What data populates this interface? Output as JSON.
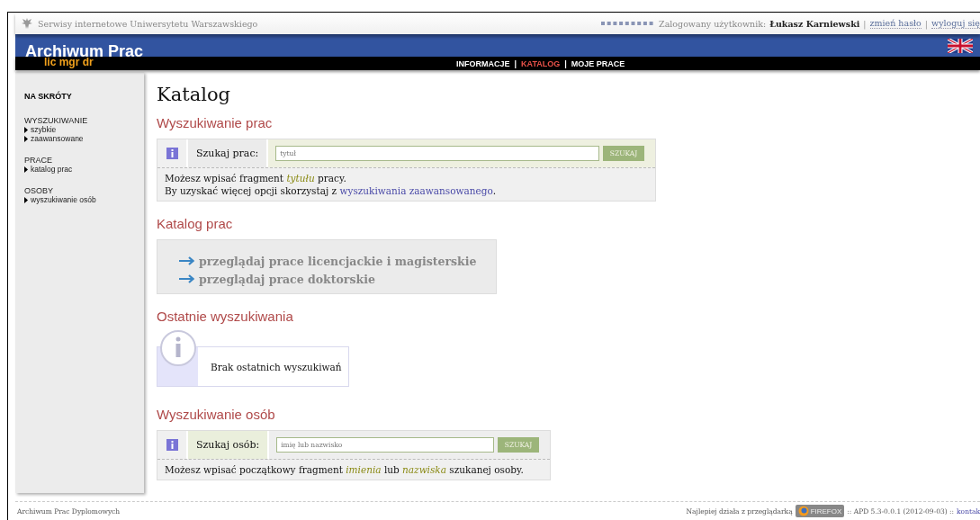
{
  "topbar": {
    "site": "Serwisy internetowe Uniwersytetu Warszawskiego",
    "logged_label": "Zalogowany użytkownik:",
    "user": "Łukasz Karniewski",
    "sep1": "|",
    "change_password": "zmień hasło",
    "sep2": "|",
    "logout": "wyloguj się"
  },
  "header": {
    "title": "Archiwum Prac",
    "subtitle": "lic mgr dr"
  },
  "nav": [
    {
      "label": "INFORMACJE",
      "selected": false
    },
    {
      "label": "KATALOG",
      "selected": true
    },
    {
      "label": "MOJE PRACE",
      "selected": false
    }
  ],
  "nav_separators": [
    "|",
    "|"
  ],
  "sidebar": {
    "title": "NA SKRÓTY",
    "groups": [
      {
        "heading": "WYSZUKIWANIE",
        "items": [
          "szybkie",
          "zaawansowane"
        ]
      },
      {
        "heading": "PRACE",
        "items": [
          "katalog prac"
        ]
      },
      {
        "heading": "OSOBY",
        "items": [
          "wyszukiwanie osób"
        ]
      }
    ]
  },
  "page_title": "Katalog",
  "work_search": {
    "heading": "Wyszukiwanie prac",
    "label": "Szukaj prac:",
    "placeholder": "tytuł",
    "button": "SZUKAJ",
    "help_line": "Możesz wpisać fragment *tytułu* pracy.",
    "help_before": "By uzyskać więcej opcji skorzystaj z",
    "help_link": "wyszukiwania zaawansowanego",
    "help_after": "."
  },
  "catalog": {
    "heading": "Katalog prac",
    "links": [
      "przeglądaj prace licencjackie i magisterskie",
      "przeglądaj prace doktorskie"
    ]
  },
  "recent": {
    "heading": "Ostatnie wyszukiwania",
    "message": "Brak ostatnich wyszukiwań"
  },
  "person_search": {
    "heading": "Wyszukiwanie osób",
    "label": "Szukaj osób:",
    "placeholder": "imię lub nazwisko",
    "button": "SZUKAJ",
    "help_line": "Możesz wpisać początkowy fragment *imienia* lub *nazwiska* szukanej osoby."
  },
  "footer": {
    "left": "Archiwum Prac Dyplomowych",
    "best": "Najlepiej działa z przeglądarką",
    "badge": "FIREFOX",
    "version": ":: APD 5.3-0.0.1 (2012-09-03) ::",
    "contact": "kontak"
  }
}
